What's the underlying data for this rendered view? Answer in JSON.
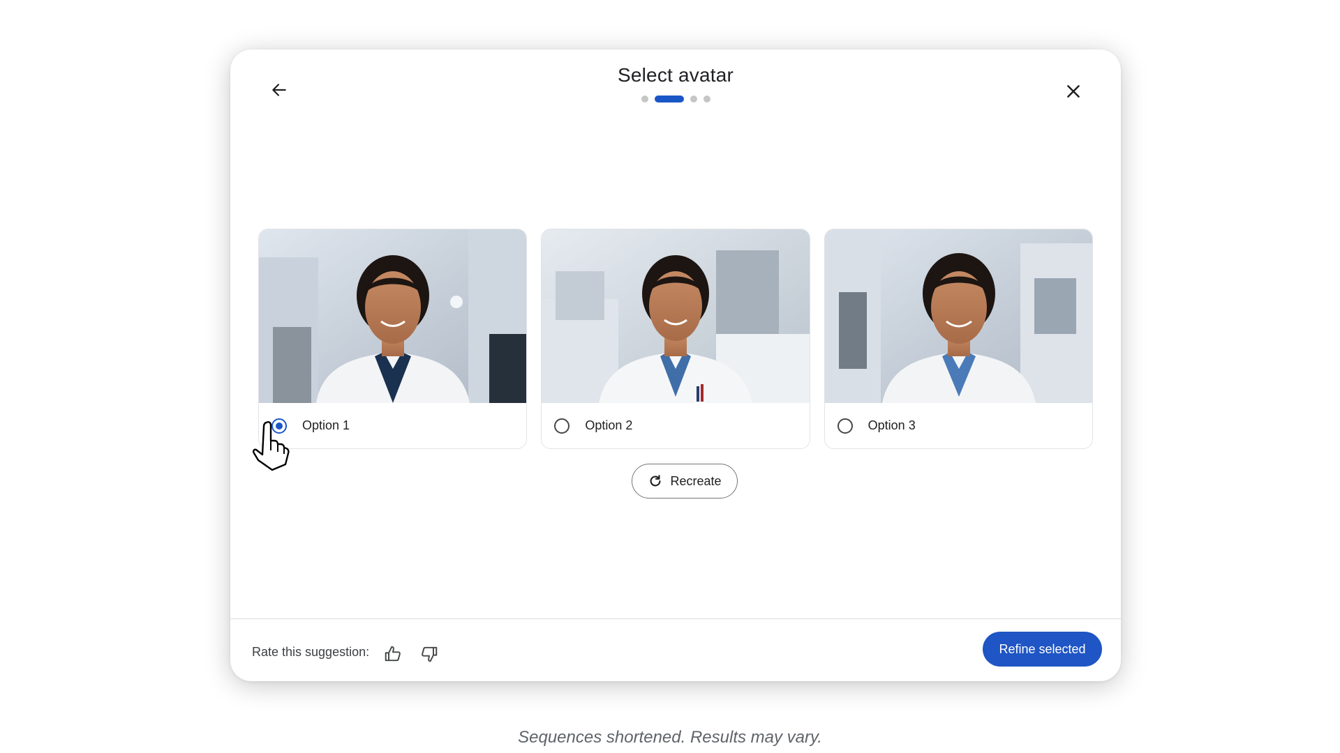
{
  "dialog": {
    "title": "Select avatar",
    "stepper": {
      "total_steps": 4,
      "current_step": 2
    },
    "options": [
      {
        "label": "Option 1",
        "selected": true,
        "image": "woman in white lab coat in laboratory"
      },
      {
        "label": "Option 2",
        "selected": false,
        "image": "woman in white lab coat in laboratory"
      },
      {
        "label": "Option 3",
        "selected": false,
        "image": "woman in white lab coat in laboratory"
      }
    ],
    "recreate_label": "Recreate",
    "rate_label": "Rate this suggestion:",
    "refine_label": "Refine selected",
    "icons": {
      "back": "arrow-back-icon",
      "close": "close-icon",
      "recreate": "refresh-icon",
      "thumbs_up": "thumbs-up-icon",
      "thumbs_down": "thumbs-down-icon"
    }
  },
  "disclaimer": "Sequences shortened. Results may vary.",
  "colors": {
    "accent": "#1a57c6",
    "button": "#1f55c4"
  }
}
